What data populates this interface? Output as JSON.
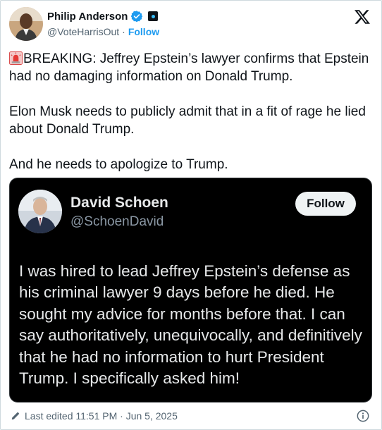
{
  "author": {
    "display_name": "Philip Anderson",
    "handle": "@VoteHarrisOut",
    "separator": "·",
    "follow_label": "Follow"
  },
  "tweet": {
    "paragraph1": "BREAKING: Jeffrey Epstein’s lawyer confirms that Epstein had no damaging information on Donald Trump.",
    "paragraph2": "Elon Musk needs to publicly admit that in a fit of rage he lied about Donald Trump.",
    "paragraph3": "And he needs to apologize to Trump."
  },
  "embedded_post": {
    "display_name": "David Schoen",
    "handle": "@SchoenDavid",
    "follow_label": "Follow",
    "text": "I was hired to lead Jeffrey Epstein’s defense as his criminal lawyer 9 days before he died. He sought my advice for months before that.  I can say authoritatively, unequivocally, and definitively that he had no information to hurt President Trump.  I specifically asked him!"
  },
  "footer": {
    "edited_label": "Last edited 11:51 PM · Jun 5, 2025"
  },
  "icons": {
    "verified": "verified-badge-icon",
    "affiliate": "affiliate-badge-icon",
    "logo": "x-logo-icon",
    "siren": "siren-emoji-icon",
    "pencil": "pencil-icon",
    "info": "info-icon"
  },
  "colors": {
    "link_blue": "#1d9bf0",
    "text": "#0f1419",
    "muted": "#536471",
    "card_bg": "#000000"
  }
}
